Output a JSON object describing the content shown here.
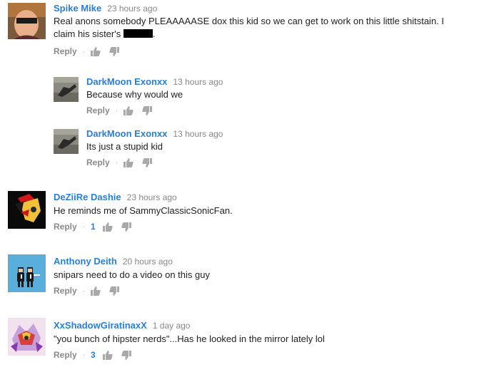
{
  "comments": [
    {
      "author": "Spike Mike",
      "time": "23 hours ago",
      "text_a": "Real anons somebody PLEAAAAASE dox this kid so we can get to work on this little shitstain. I claim his sister's ",
      "text_b": ".",
      "reply": "Reply",
      "likes": ""
    },
    {
      "author": "DarkMoon Exonxx",
      "time": "13 hours ago",
      "text": "Because why would we",
      "reply": "Reply",
      "likes": ""
    },
    {
      "author": "DarkMoon Exonxx",
      "time": "13 hours ago",
      "text": "Its just a stupid kid",
      "reply": "Reply",
      "likes": ""
    },
    {
      "author": "DeZiiRe Dashie",
      "time": "23 hours ago",
      "text": "He reminds me of SammyClassicSonicFan.",
      "reply": "Reply",
      "likes": "1"
    },
    {
      "author": "Anthony Deith",
      "time": "20 hours ago",
      "text": "snipars need to do a video on this guy",
      "reply": "Reply",
      "likes": ""
    },
    {
      "author": "XxShadowGiratinaxX",
      "time": "1 day ago",
      "text": "\"you bunch of hipster nerds\"...Has he looked in the mirror lately lol",
      "reply": "Reply",
      "likes": "3"
    }
  ],
  "colors": {
    "author": "#2b7ed6",
    "muted": "#8a8a8a"
  },
  "icons": [
    "thumbs-up-icon",
    "thumbs-down-icon",
    "separator-dot"
  ]
}
